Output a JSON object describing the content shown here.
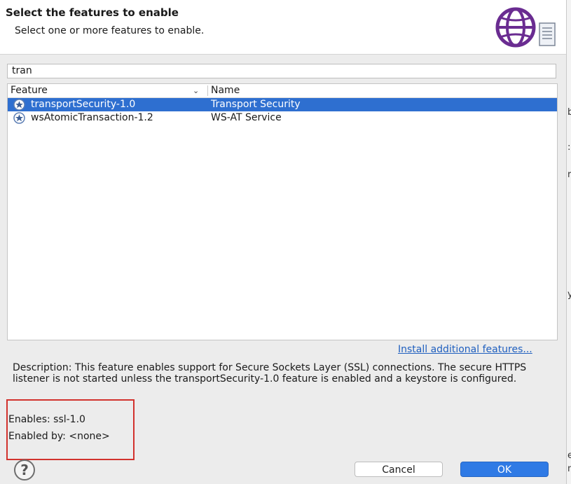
{
  "header": {
    "title": "Select the features to enable",
    "subtitle": "Select one or more features to enable."
  },
  "filter": {
    "value": "tran"
  },
  "table": {
    "columns": {
      "feature": "Feature",
      "name": "Name"
    },
    "rows": [
      {
        "feature": "transportSecurity-1.0",
        "name": "Transport Security",
        "selected": true
      },
      {
        "feature": "wsAtomicTransaction-1.2",
        "name": "WS-AT Service",
        "selected": false
      }
    ]
  },
  "install_link": "Install additional features...",
  "description": "Description: This feature enables support for Secure Sockets Layer (SSL) connections. The secure HTTPS listener is not started unless the transportSecurity-1.0 feature is enabled and a keystore is configured.",
  "enables": "Enables: ssl-1.0",
  "enabled_by": "Enabled by: <none>",
  "buttons": {
    "cancel": "Cancel",
    "ok": "OK",
    "help": "?"
  },
  "background_window": {
    "chars": [
      "b",
      ":.",
      "r",
      "y",
      "e",
      "m"
    ]
  },
  "colors": {
    "selection": "#2e6fd0",
    "ok_button": "#2f7ae5",
    "link": "#1f5fbf",
    "highlight_box": "#d2322d",
    "logo": "#6a2c91"
  }
}
